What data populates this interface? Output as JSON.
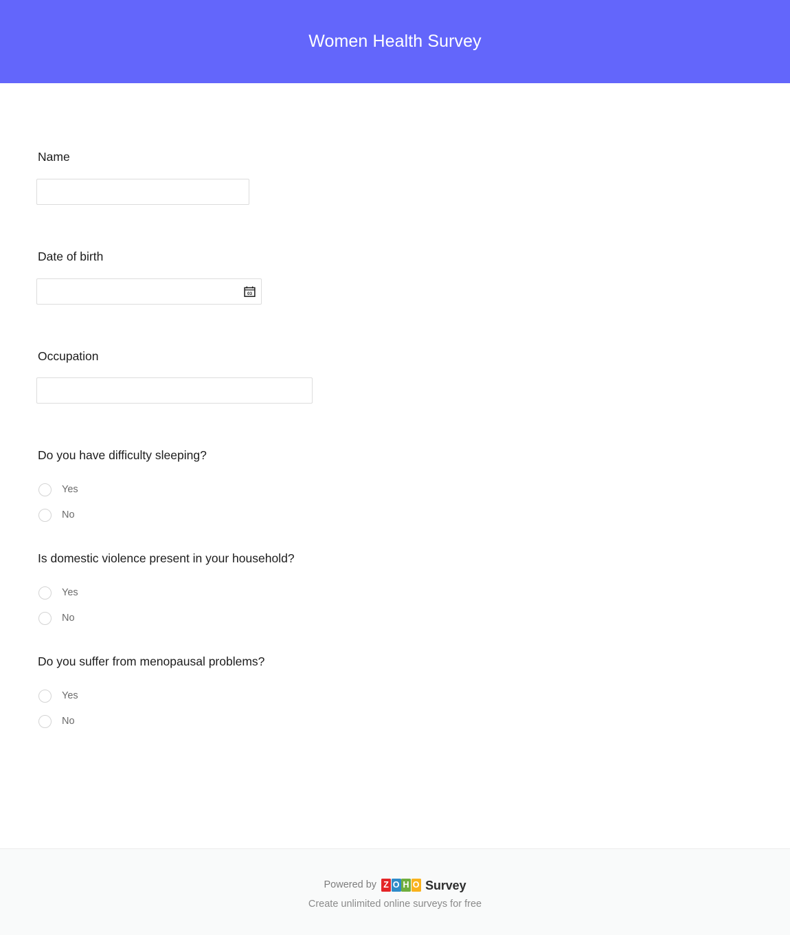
{
  "header": {
    "title": "Women Health Survey",
    "background_color": "#6366fb",
    "title_color": "#ffffff"
  },
  "form": {
    "questions": [
      {
        "id": "name",
        "label": "Name",
        "type": "text",
        "value": "",
        "placeholder": ""
      },
      {
        "id": "date-of-birth",
        "label": "Date of birth",
        "type": "date",
        "value": "",
        "placeholder": "",
        "icon": "calendar-icon",
        "icon_day_text": "03"
      },
      {
        "id": "occupation",
        "label": "Occupation",
        "type": "text",
        "value": "",
        "placeholder": ""
      },
      {
        "id": "difficulty-sleeping",
        "label": "Do you have difficulty sleeping?",
        "type": "radio",
        "options": [
          "Yes",
          "No"
        ],
        "selected": null
      },
      {
        "id": "domestic-violence",
        "label": "Is domestic violence present in your household?",
        "type": "radio",
        "options": [
          "Yes",
          "No"
        ],
        "selected": null
      },
      {
        "id": "menopausal-problems",
        "label": "Do you suffer from menopausal problems?",
        "type": "radio",
        "options": [
          "Yes",
          "No"
        ],
        "selected": null
      }
    ]
  },
  "footer": {
    "powered_by": "Powered by",
    "brand_letters": [
      {
        "char": "Z",
        "color": "#e42527"
      },
      {
        "char": "O",
        "color": "#2f8bc9"
      },
      {
        "char": "H",
        "color": "#6fae3e"
      },
      {
        "char": "O",
        "color": "#f9b21d"
      }
    ],
    "product_name": "Survey",
    "tagline": "Create unlimited online surveys for free",
    "background_color": "#f9fafa"
  }
}
